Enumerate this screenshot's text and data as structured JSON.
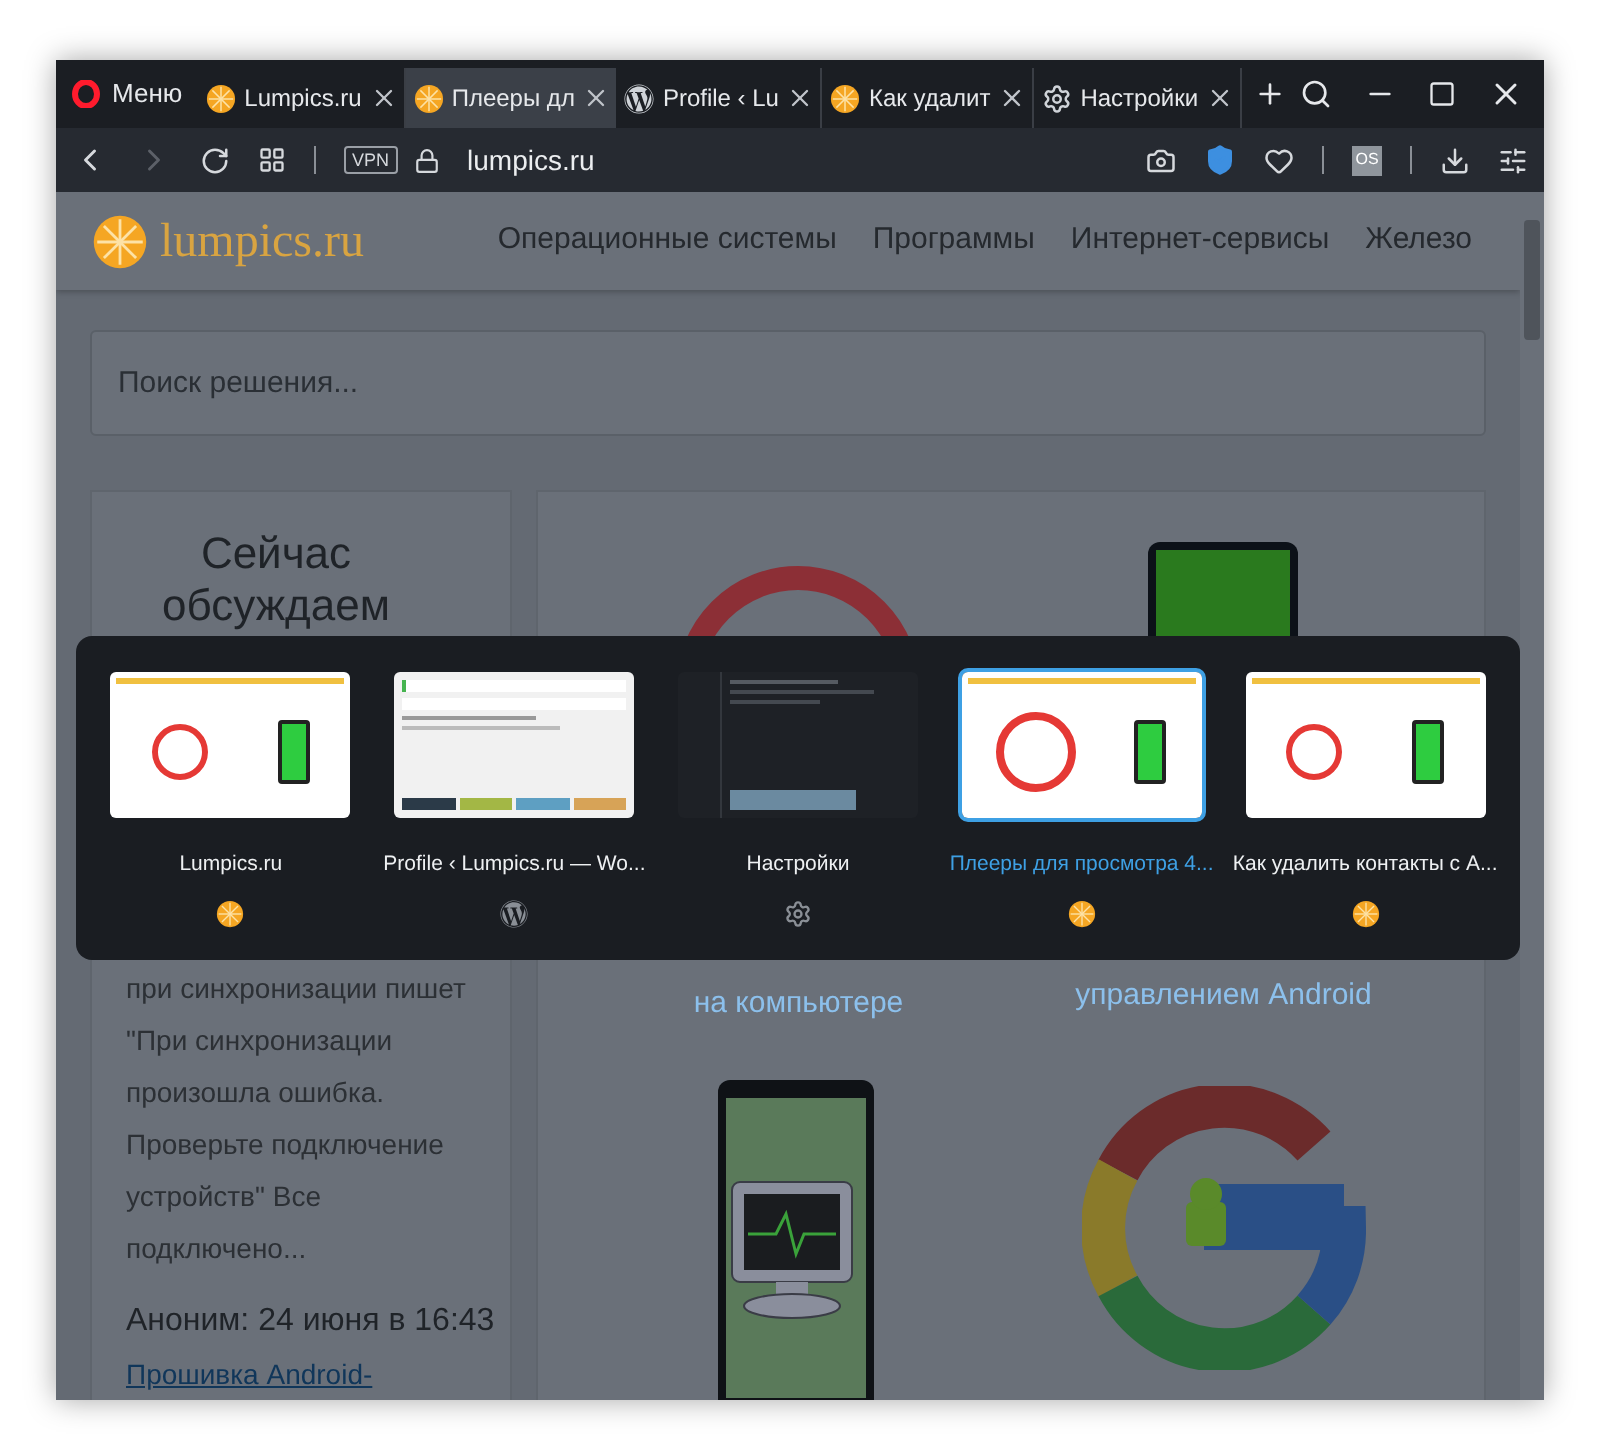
{
  "tab_bar": {
    "menu": {
      "label": "Меню"
    },
    "tabs": [
      {
        "title": "Lumpics.ru",
        "kind": "lumpics",
        "selected": false
      },
      {
        "title": "Плееры дл",
        "kind": "lumpics",
        "selected": true
      },
      {
        "title": "Profile ‹ Lu",
        "kind": "wordpress",
        "selected": false
      },
      {
        "title": "Как удалит",
        "kind": "lumpics",
        "selected": false
      },
      {
        "title": "Настройки",
        "kind": "settings",
        "selected": false
      }
    ]
  },
  "address_bar": {
    "forward_disabled": true,
    "vpn_badge": "VPN",
    "url": "lumpics.ru",
    "profile_badge": "OS"
  },
  "page": {
    "logo": "lumpics.ru",
    "nav": [
      "Операционные системы",
      "Программы",
      "Интернет-сервисы",
      "Железо"
    ],
    "search": {
      "placeholder": "Поиск решения..."
    },
    "sidebar": {
      "heading": "Сейчас обсуждаем",
      "comment": "при синхронизации пишет \"При синхронизации произошла ошибка. Проверьте подключение устройств\" Все подключено...",
      "author": "Аноним: 24 июня в 16:43",
      "link": "Прошивка Android-"
    },
    "articles": [
      {
        "title": "на компьютере",
        "kind": "monitor"
      },
      {
        "title": "управлением Android",
        "kind": "google"
      }
    ]
  },
  "tab_switcher": {
    "items": [
      {
        "title": "Lumpics.ru",
        "kind": "lumpics",
        "selected": false
      },
      {
        "title": "Profile ‹ Lumpics.ru — Wo...",
        "kind": "wordpress",
        "selected": false
      },
      {
        "title": "Настройки",
        "kind": "settings",
        "selected": false
      },
      {
        "title": "Плееры для просмотра 4...",
        "kind": "lumpics",
        "selected": true
      },
      {
        "title": "Как удалить контакты с A...",
        "kind": "lumpics",
        "selected": false
      }
    ]
  }
}
